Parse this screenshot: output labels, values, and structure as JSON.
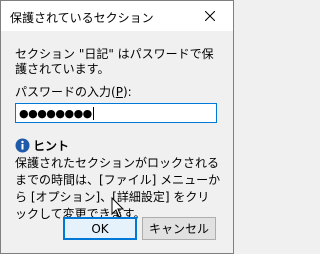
{
  "window": {
    "title": "保護されているセクション"
  },
  "dialog": {
    "message": "セクション \"日記\" はパスワードで保護されています。",
    "password_label_prefix": "パスワードの入力(",
    "password_label_mnemonic": "P",
    "password_label_suffix": "):",
    "password_value": "●●●●●●●●"
  },
  "hint": {
    "title": "ヒント",
    "body": "保護されたセクションがロックされるまでの時間は、[ファイル] メニューから [オプション]、[詳細設定] をクリックして変更できます。"
  },
  "buttons": {
    "ok_label": "OK",
    "cancel_label": "キャンセル"
  },
  "icons": {
    "close": "close-icon",
    "info": "info-icon",
    "cursor": "mouse-pointer-icon"
  },
  "colors": {
    "accent": "#0078d7",
    "info_icon": "#1e5aa8"
  }
}
